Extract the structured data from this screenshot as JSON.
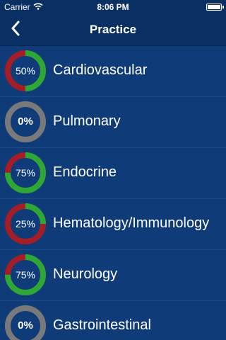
{
  "status_bar": {
    "carrier": "Carrier",
    "time": "8:06 PM",
    "wifi_icon": "wifi-icon",
    "battery_icon": "battery-icon"
  },
  "nav": {
    "title": "Practice",
    "back_icon": "chevron-left-icon"
  },
  "colors": {
    "correct": "#2da836",
    "incorrect": "#a41c24",
    "unattempted": "#7a7a7a",
    "background": "#103b79"
  },
  "topics": [
    {
      "title": "Cardiovascular",
      "percent_label": "50%",
      "correct_fraction": 0.5,
      "attempted": true
    },
    {
      "title": "Pulmonary",
      "percent_label": "0%",
      "correct_fraction": 0,
      "attempted": false
    },
    {
      "title": "Endocrine",
      "percent_label": "75%",
      "correct_fraction": 0.75,
      "attempted": true
    },
    {
      "title": "Hematology/Immunology",
      "percent_label": "25%",
      "correct_fraction": 0.25,
      "attempted": true
    },
    {
      "title": "Neurology",
      "percent_label": "75%",
      "correct_fraction": 0.75,
      "attempted": true
    },
    {
      "title": "Gastrointestinal",
      "percent_label": "0%",
      "correct_fraction": 0,
      "attempted": false
    }
  ]
}
